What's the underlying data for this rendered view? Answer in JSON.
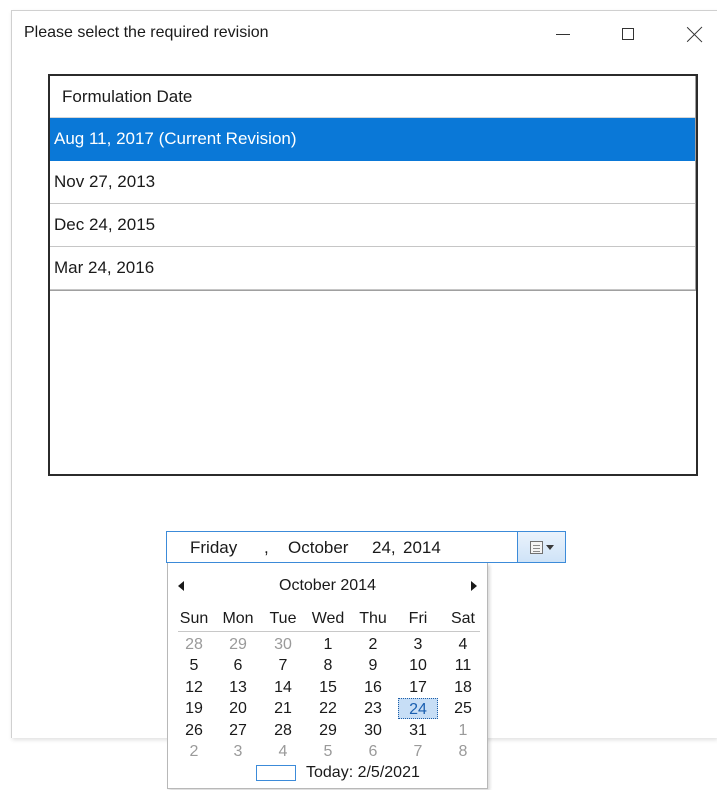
{
  "window": {
    "title": "Please select the required revision"
  },
  "grid": {
    "column_header": "Formulation Date",
    "rows": [
      "Aug 11, 2017 (Current Revision)",
      "Nov 27, 2013",
      "Dec 24, 2015",
      "Mar 24, 2016"
    ],
    "selected_index": 0,
    "selected_color": "#0a78d7"
  },
  "date_picker": {
    "day_name": "Friday",
    "comma": ",",
    "month": "October",
    "date": "24,",
    "year": "2014",
    "button_icon": "calendar-dropdown-icon"
  },
  "calendar": {
    "title": "October 2014",
    "weekdays": [
      "Sun",
      "Mon",
      "Tue",
      "Wed",
      "Thu",
      "Fri",
      "Sat"
    ],
    "weeks": [
      [
        "28",
        "29",
        "30",
        "1",
        "2",
        "3",
        "4"
      ],
      [
        "5",
        "6",
        "7",
        "8",
        "9",
        "10",
        "11"
      ],
      [
        "12",
        "13",
        "14",
        "15",
        "16",
        "17",
        "18"
      ],
      [
        "19",
        "20",
        "21",
        "22",
        "23",
        "24",
        "25"
      ],
      [
        "26",
        "27",
        "28",
        "29",
        "30",
        "31",
        "1"
      ],
      [
        "2",
        "3",
        "4",
        "5",
        "6",
        "7",
        "8"
      ]
    ],
    "other_month_cells": [
      [
        0,
        0
      ],
      [
        0,
        1
      ],
      [
        0,
        2
      ],
      [
        4,
        6
      ],
      [
        5,
        0
      ],
      [
        5,
        1
      ],
      [
        5,
        2
      ],
      [
        5,
        3
      ],
      [
        5,
        4
      ],
      [
        5,
        5
      ],
      [
        5,
        6
      ]
    ],
    "selected_cell": [
      3,
      5
    ],
    "today_label": "Today: 2/5/2021",
    "selected_color": "#c7def6"
  }
}
